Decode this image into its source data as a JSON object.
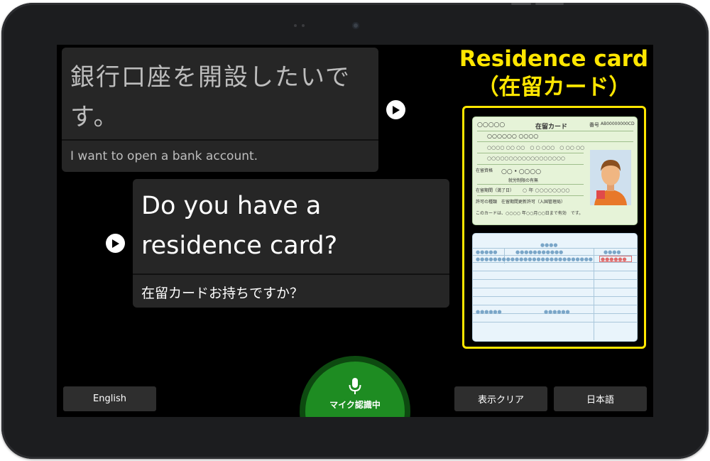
{
  "conversation": {
    "message_1": {
      "main_text": "銀行口座を開設したいです。",
      "translation": "I want to open a bank account."
    },
    "message_2": {
      "main_text": "Do you have a residence card?",
      "translation": "在留カードお持ちですか？"
    }
  },
  "reference_panel": {
    "title_line_1": "Residence card",
    "title_line_2": "（在留カード）",
    "card_front_heading": "在留カード",
    "card_front_circles": "○○○○○",
    "card_front_number_label": "番号",
    "card_front_number": "AB00000000CD",
    "card_front_name_row": "○○○○○○ ○○○○",
    "card_front_validity": "このカードは、○○○○ 年○○月○○日まで有効　です。",
    "card_front_status": "在留資格",
    "card_front_status_value": "○○・○○○○",
    "card_front_period_label": "在留期間（満了日）",
    "card_front_permission": "許可の種類　在留期間更新許可（入国管理局）",
    "card_front_work": "就労制限の有無"
  },
  "controls": {
    "english_label": "English",
    "clear_label": "表示クリア",
    "japanese_label": "日本語",
    "mic_label": "マイク認識中"
  },
  "colors": {
    "accent_yellow": "#ffe600",
    "mic_green": "#1e8c22",
    "mic_ring": "#0d4a10",
    "bubble_bg": "#262626"
  },
  "icons": {
    "play": "play-icon",
    "mic": "microphone-icon"
  }
}
